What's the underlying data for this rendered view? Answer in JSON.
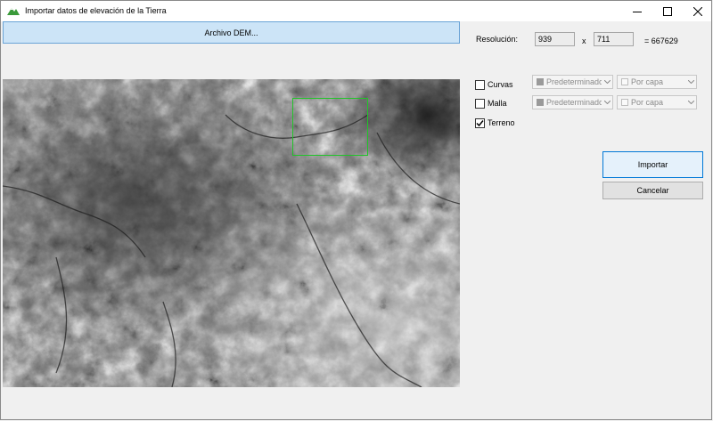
{
  "window": {
    "title": "Importar datos de elevación de la Tierra",
    "icons": {
      "app": "app-icon",
      "minimize": "minimize-icon",
      "maximize": "maximize-icon",
      "close": "close-icon"
    }
  },
  "dem_button_label": "Archivo DEM...",
  "resolution": {
    "label": "Resolución:",
    "width": "939",
    "times": "x",
    "height": "711",
    "product": "= 667629"
  },
  "options": {
    "curvas": {
      "label": "Curvas",
      "checked": false,
      "color": "Predeterminado",
      "linetype": "Por capa"
    },
    "malla": {
      "label": "Malla",
      "checked": false,
      "color": "Predeterminado",
      "linetype": "Por capa"
    },
    "terreno": {
      "label": "Terreno",
      "checked": true
    }
  },
  "buttons": {
    "import": "Importar",
    "cancel": "Cancelar"
  },
  "colors": {
    "selection": "#22c32a",
    "primary_border": "#0078d7",
    "dem_button_bg": "#cce4f7"
  }
}
